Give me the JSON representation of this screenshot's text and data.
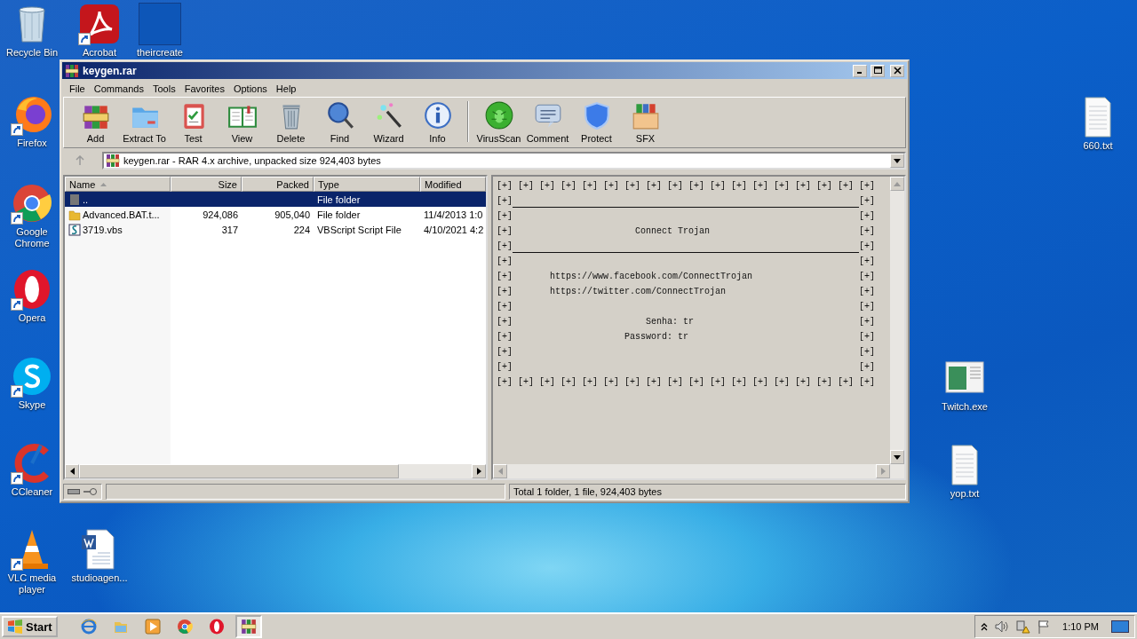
{
  "desktop_icons": [
    {
      "label": "Recycle Bin",
      "kind": "bin",
      "shortcut": false
    },
    {
      "label": "Acrobat",
      "kind": "pdf",
      "shortcut": true
    },
    {
      "label": "theircreate",
      "kind": "blank",
      "shortcut": false
    },
    {
      "label": "Firefox",
      "kind": "firefox",
      "shortcut": true
    },
    {
      "label": "Google Chrome",
      "kind": "chrome",
      "shortcut": true
    },
    {
      "label": "Opera",
      "kind": "opera",
      "shortcut": true
    },
    {
      "label": "Skype",
      "kind": "skype",
      "shortcut": true
    },
    {
      "label": "CCleaner",
      "kind": "ccleaner",
      "shortcut": true
    },
    {
      "label": "VLC media player",
      "kind": "vlc",
      "shortcut": true
    },
    {
      "label": "studioagen...",
      "kind": "word",
      "shortcut": false
    },
    {
      "label": "660.txt",
      "kind": "text",
      "shortcut": false
    },
    {
      "label": "Twitch.exe",
      "kind": "app",
      "shortcut": false
    },
    {
      "label": "yop.txt",
      "kind": "text",
      "shortcut": false
    }
  ],
  "window": {
    "title": "keygen.rar",
    "menu": [
      "File",
      "Commands",
      "Tools",
      "Favorites",
      "Options",
      "Help"
    ],
    "toolbar": [
      {
        "label": "Add"
      },
      {
        "label": "Extract To"
      },
      {
        "label": "Test"
      },
      {
        "label": "View"
      },
      {
        "label": "Delete"
      },
      {
        "label": "Find"
      },
      {
        "label": "Wizard"
      },
      {
        "label": "Info"
      },
      {
        "label": "VirusScan"
      },
      {
        "label": "Comment"
      },
      {
        "label": "Protect"
      },
      {
        "label": "SFX"
      }
    ],
    "address": "keygen.rar - RAR 4.x archive, unpacked size 924,403 bytes",
    "table": {
      "columns": [
        "Name",
        "Size",
        "Packed",
        "Type",
        "Modified"
      ],
      "rows": [
        {
          "name": "..",
          "size": "",
          "packed": "",
          "type": "File folder",
          "modified": "",
          "kind": "up",
          "selected": true
        },
        {
          "name": "Advanced.BAT.t...",
          "size": "924,086",
          "packed": "905,040",
          "type": "File folder",
          "modified": "11/4/2013 1:0",
          "kind": "folder",
          "selected": false
        },
        {
          "name": "3719.vbs",
          "size": "317",
          "packed": "224",
          "type": "VBScript Script File",
          "modified": "4/10/2021 4:2",
          "kind": "script",
          "selected": false
        }
      ]
    },
    "comment": [
      {
        "kind": "border",
        "text": "[+] [+] [+] [+] [+] [+] [+] [+] [+] [+] [+] [+] [+] [+] [+] [+] [+] [+]"
      },
      {
        "kind": "rule",
        "left": "[+]",
        "right": "[+]"
      },
      {
        "kind": "text",
        "left": "[+]",
        "right": "[+]"
      },
      {
        "kind": "text",
        "left": "[+]",
        "text": "                       Connect Trojan",
        "right": "[+]"
      },
      {
        "kind": "rule",
        "left": "[+]",
        "right": "[+]"
      },
      {
        "kind": "text",
        "left": "[+]",
        "right": "[+]"
      },
      {
        "kind": "text",
        "left": "[+]",
        "text": "       https://www.facebook.com/ConnectTrojan",
        "right": "[+]"
      },
      {
        "kind": "text",
        "left": "[+]",
        "text": "       https://twitter.com/ConnectTrojan",
        "right": "[+]"
      },
      {
        "kind": "text",
        "left": "[+]",
        "right": "[+]"
      },
      {
        "kind": "text",
        "left": "[+]",
        "text": "                         Senha: tr",
        "right": "[+]"
      },
      {
        "kind": "text",
        "left": "[+]",
        "text": "                     Password: tr",
        "right": "[+]"
      },
      {
        "kind": "text",
        "left": "[+]",
        "right": "[+]"
      },
      {
        "kind": "text",
        "left": "[+]",
        "right": "[+]"
      },
      {
        "kind": "border",
        "text": "[+] [+] [+] [+] [+] [+] [+] [+] [+] [+] [+] [+] [+] [+] [+] [+] [+] [+]"
      }
    ],
    "status": "Total 1 folder, 1 file, 924,403 bytes"
  },
  "taskbar": {
    "start": "Start",
    "apps": [
      {
        "kind": "ie",
        "active": false
      },
      {
        "kind": "explorer",
        "active": false
      },
      {
        "kind": "media",
        "active": false
      },
      {
        "kind": "chrome",
        "active": false
      },
      {
        "kind": "opera",
        "active": false
      },
      {
        "kind": "winrar",
        "active": true
      }
    ],
    "clock": "1:10 PM"
  }
}
